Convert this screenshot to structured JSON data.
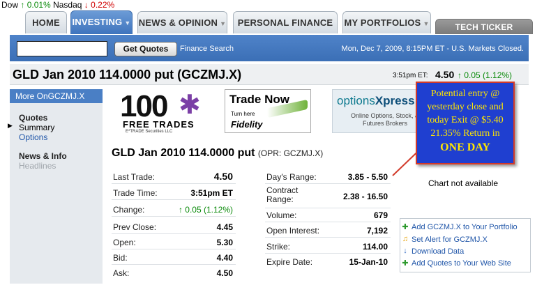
{
  "ticker": {
    "dow_label": "Dow",
    "dow_change": "0.01%",
    "nasdaq_label": "Nasdaq",
    "nasdaq_change": "0.22%"
  },
  "tabs": [
    {
      "label": "HOME"
    },
    {
      "label": "INVESTING"
    },
    {
      "label": "NEWS & OPINION"
    },
    {
      "label": "PERSONAL FINANCE"
    },
    {
      "label": "MY PORTFOLIOS"
    },
    {
      "label": "TECH TICKER"
    }
  ],
  "toolbar": {
    "search_value": "",
    "get_quotes_label": "Get Quotes",
    "finance_search_label": "Finance Search",
    "market_status": "Mon, Dec 7, 2009, 8:15PM ET - U.S. Markets Closed."
  },
  "quote": {
    "title": "GLD Jan 2010 114.0000 put (GCZMJ.X)",
    "time": "3:51pm ET:",
    "price": "4.50",
    "change": "0.05 (1.12%)"
  },
  "sidebar": {
    "header": "More OnGCZMJ.X",
    "quotes": "Quotes",
    "summary": "Summary",
    "options": "Options",
    "news_info": "News & Info",
    "headlines": "Headlines"
  },
  "ads": {
    "etrade": {
      "number": "100",
      "text": "FREE TRADES",
      "small": "E*TRADE Securities LLC"
    },
    "fidelity": {
      "title": "Trade Now",
      "turn": "Turn here",
      "brand": "Fidelity"
    },
    "optionsxpress": {
      "brand_a": "options",
      "brand_b": "Xpress",
      "text": "Online Options, Stock, & Futures Brokers"
    }
  },
  "callout": {
    "line1": "Potential entry @",
    "line2": "yesterday close and",
    "line3": "today Exit @ $5.40",
    "line4": "21.35% Return in",
    "line5": "ONE DAY"
  },
  "main": {
    "title": "GLD Jan 2010 114.0000 put",
    "opr": "(OPR: GCZMJ.X)",
    "left_rows": [
      {
        "label": "Last Trade:",
        "value": "4.50"
      },
      {
        "label": "Trade Time:",
        "value": "3:51pm ET"
      },
      {
        "label": "Change:",
        "value": "0.05 (1.12%)"
      },
      {
        "label": "Prev Close:",
        "value": "4.45"
      },
      {
        "label": "Open:",
        "value": "5.30"
      },
      {
        "label": "Bid:",
        "value": "4.40"
      },
      {
        "label": "Ask:",
        "value": "4.50"
      }
    ],
    "right_rows": [
      {
        "label": "Day's Range:",
        "value": "3.85 - 5.50"
      },
      {
        "label": "Contract Range:",
        "label_line1": "Contract",
        "label_line2": "Range:",
        "value": "2.38 - 16.50"
      },
      {
        "label": "Volume:",
        "value": "679"
      },
      {
        "label": "Open Interest:",
        "value": "7,192"
      },
      {
        "label": "Strike:",
        "value": "114.00"
      },
      {
        "label": "Expire Date:",
        "value": "15-Jan-10"
      }
    ],
    "chart_status": "Chart not available"
  },
  "actions": [
    {
      "label": "Add GCZMJ.X to Your Portfolio",
      "icon": "plus-icon"
    },
    {
      "label": "Set Alert for GCZMJ.X",
      "icon": "bell-icon"
    },
    {
      "label": "Download Data",
      "icon": "download-icon"
    },
    {
      "label": "Add Quotes to Your Web Site",
      "icon": "plus-icon"
    }
  ],
  "colors": {
    "brand_blue": "#3b6fb6",
    "up_green": "#0a8a0a",
    "down_red": "#d00000",
    "callout_bg": "#1f3fd0",
    "callout_text": "#ffe600"
  }
}
